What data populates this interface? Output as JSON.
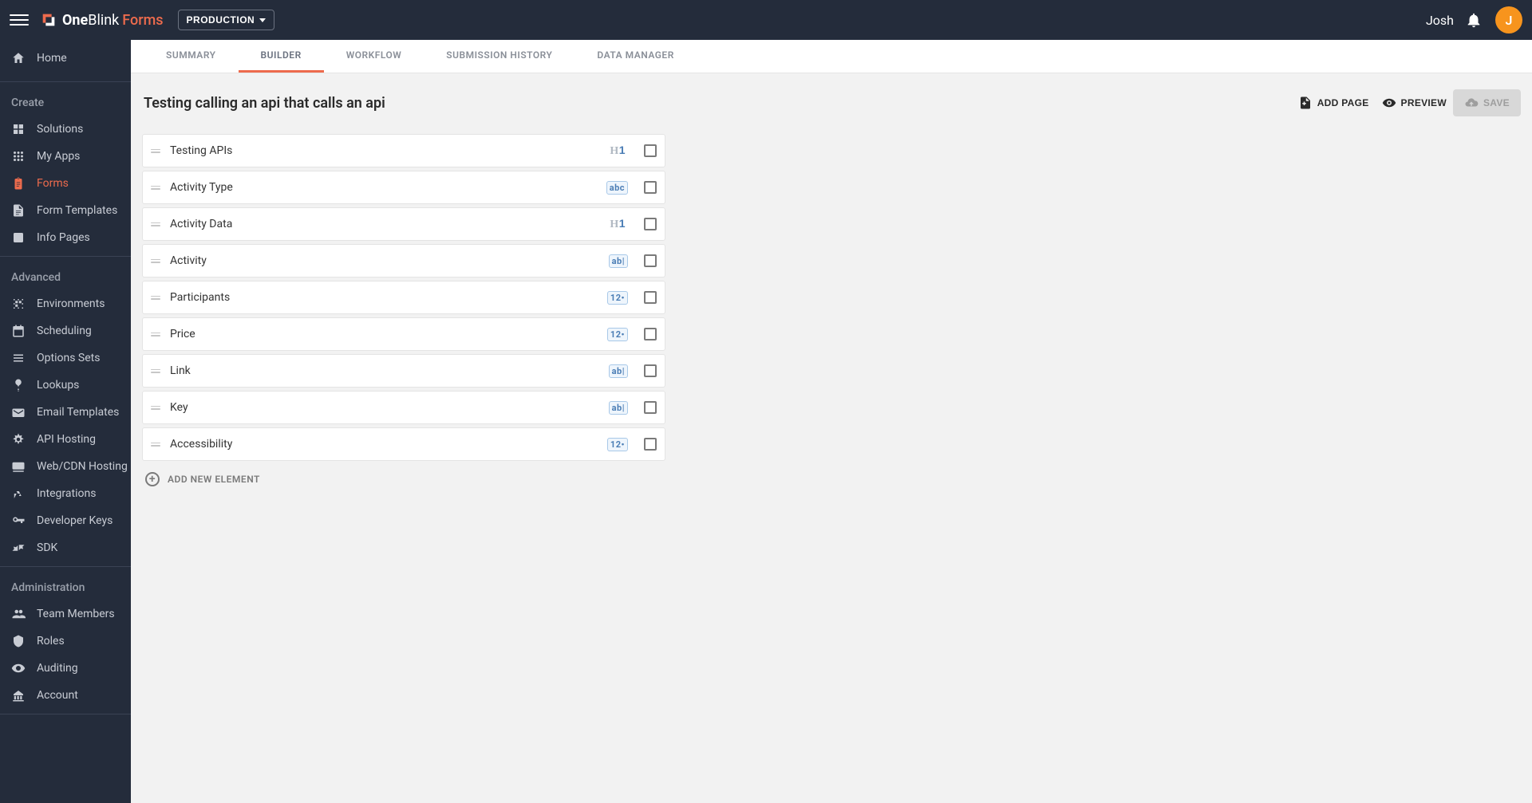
{
  "brand": {
    "one": "One",
    "blink": "Blink",
    "forms": "Forms"
  },
  "environment": "PRODUCTION",
  "user": {
    "name": "Josh",
    "initial": "J"
  },
  "sidebar": {
    "home": "Home",
    "create_header": "Create",
    "create": [
      {
        "icon": "solutions",
        "label": "Solutions"
      },
      {
        "icon": "apps",
        "label": "My Apps"
      },
      {
        "icon": "forms",
        "label": "Forms",
        "active": true
      },
      {
        "icon": "templates",
        "label": "Form Templates"
      },
      {
        "icon": "info",
        "label": "Info Pages"
      }
    ],
    "advanced_header": "Advanced",
    "advanced": [
      {
        "icon": "env",
        "label": "Environments"
      },
      {
        "icon": "sched",
        "label": "Scheduling"
      },
      {
        "icon": "opts",
        "label": "Options Sets"
      },
      {
        "icon": "lookups",
        "label": "Lookups"
      },
      {
        "icon": "email",
        "label": "Email Templates"
      },
      {
        "icon": "api",
        "label": "API Hosting"
      },
      {
        "icon": "cdn",
        "label": "Web/CDN Hosting"
      },
      {
        "icon": "integrations",
        "label": "Integrations"
      },
      {
        "icon": "devkeys",
        "label": "Developer Keys"
      },
      {
        "icon": "sdk",
        "label": "SDK"
      }
    ],
    "admin_header": "Administration",
    "admin": [
      {
        "icon": "team",
        "label": "Team Members"
      },
      {
        "icon": "roles",
        "label": "Roles"
      },
      {
        "icon": "audit",
        "label": "Auditing"
      },
      {
        "icon": "account",
        "label": "Account"
      }
    ]
  },
  "tabs": [
    {
      "label": "SUMMARY"
    },
    {
      "label": "BUILDER",
      "active": true
    },
    {
      "label": "WORKFLOW"
    },
    {
      "label": "SUBMISSION HISTORY"
    },
    {
      "label": "DATA MANAGER"
    }
  ],
  "form_title": "Testing calling an api that calls an api",
  "actions": {
    "add_page": "ADD PAGE",
    "preview": "PREVIEW",
    "save": "SAVE"
  },
  "elements": [
    {
      "label": "Testing APIs",
      "type": "h1"
    },
    {
      "label": "Activity Type",
      "type": "abc"
    },
    {
      "label": "Activity Data",
      "type": "h1"
    },
    {
      "label": "Activity",
      "type": "abl"
    },
    {
      "label": "Participants",
      "type": "num"
    },
    {
      "label": "Price",
      "type": "num"
    },
    {
      "label": "Link",
      "type": "abl"
    },
    {
      "label": "Key",
      "type": "abl"
    },
    {
      "label": "Accessibility",
      "type": "num"
    }
  ],
  "add_new_element": "ADD NEW ELEMENT"
}
